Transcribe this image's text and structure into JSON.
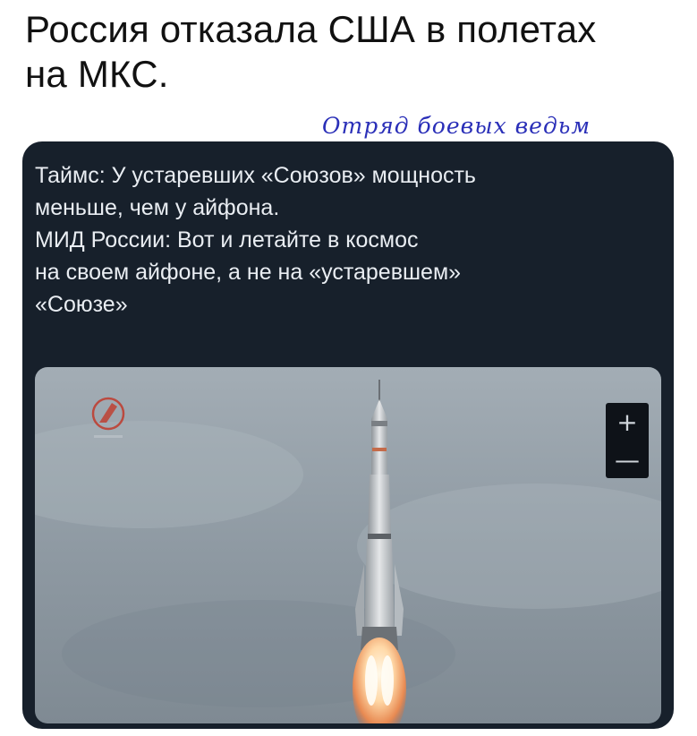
{
  "headline": {
    "line1": "Россия отказала США в полетах",
    "line2": "на МКС."
  },
  "watermark": "Отряд боевых ведьм",
  "quote": {
    "lines": [
      "Таймс: У устаревших «Союзов» мощность",
      "меньше, чем у айфона.",
      "МИД России: Вот и летайте в космос",
      "на своем айфоне, а не на «устаревшем»",
      "«Союзе»"
    ]
  },
  "zoom_controls": {
    "plus_label": "+",
    "minus_label": "—"
  },
  "colors": {
    "card_background": "#17202b",
    "quote_text": "#e9edf2",
    "watermark": "#2a2fb8",
    "sky": "#8f9aa3"
  },
  "icons": {
    "logo": "roscosmos-logo-icon",
    "zoom_in": "plus-icon",
    "zoom_out": "minus-icon"
  }
}
